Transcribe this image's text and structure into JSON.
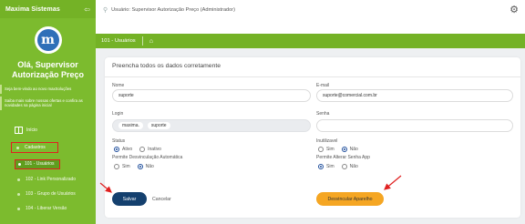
{
  "sidebar": {
    "brand": "Maxima Sistemas",
    "greeting": "Olá, Supervisor Autorização Preço",
    "info_1": "Seja bem-vindo ao novo maxSoluções",
    "info_2": "Saiba mais sobre nossas ofertas e confira as novidades na página inicial",
    "inicio": "Início",
    "cadastros": "Cadastros",
    "usuarios": "101 - Usuários",
    "item_102": "102 - Link Personalizado",
    "item_103": "103 - Grupo de Usuários",
    "item_104": "104 - Liberar Versão"
  },
  "topbar": {
    "user_text": "Usuário: Supervisor Autorização Preço (Administrador)"
  },
  "breadcrumb": {
    "page": "101 - Usuários"
  },
  "form": {
    "title": "Preencha todos os dados corretamente",
    "nome_label": "Nome",
    "nome_value": "suporte",
    "email_label": "E-mail",
    "email_value": "suporte@comercial.com.br",
    "login_label": "Login",
    "login_prefix": "maxima.",
    "login_value": "suporte",
    "senha_label": "Senha",
    "senha_value": "",
    "status_label": "Status",
    "status_options": [
      "Ativo",
      "Inativo"
    ],
    "inutilizavel_label": "Inutilizavel",
    "inutilizavel_options": [
      "Sim",
      "Não"
    ],
    "desvinc_label": "Permite Desvinculação Automática",
    "desvinc_options": [
      "Sim",
      "Não"
    ],
    "alterar_senha_label": "Permite Alterar Senha App",
    "alterar_senha_options": [
      "Sim",
      "Não"
    ],
    "save_label": "Salvar",
    "cancel_label": "Cancelar",
    "unlink_label": "Desvincular Aparelho"
  },
  "colors": {
    "sidebar": "#7cbb2e",
    "primary_button": "#14406e",
    "warning_button": "#f5a623",
    "annotation": "#e02020"
  }
}
